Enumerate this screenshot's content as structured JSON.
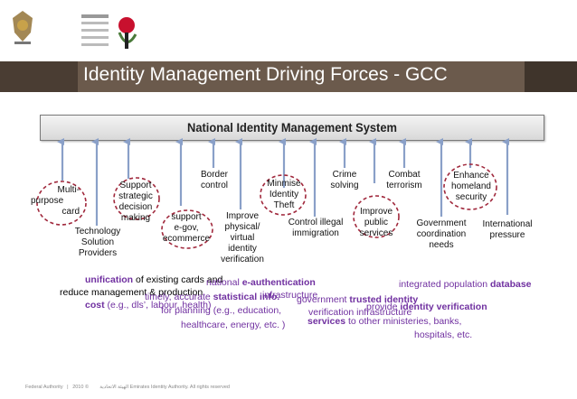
{
  "title": "Identity Management Driving Forces - GCC",
  "system_label": "National Identity Management System",
  "forces": [
    {
      "id": "multi",
      "text": [
        "Multi-",
        "purpose",
        "card"
      ]
    },
    {
      "id": "tech",
      "text": [
        "Technology",
        "Solution",
        "Providers"
      ]
    },
    {
      "id": "decision",
      "text": [
        "Support",
        "strategic",
        "decision",
        "making"
      ]
    },
    {
      "id": "egov",
      "text": [
        "support",
        "e-gov,",
        "ecommerce"
      ]
    },
    {
      "id": "border",
      "text": [
        "Border",
        "control"
      ]
    },
    {
      "id": "verify",
      "text": [
        "Improve",
        "physical/",
        "virtual",
        "identity",
        "verification"
      ]
    },
    {
      "id": "theft",
      "text": [
        "Minmise",
        "Identity",
        "Theft"
      ]
    },
    {
      "id": "illegal",
      "text": [
        "Control illegal",
        "immigration"
      ]
    },
    {
      "id": "crime",
      "text": [
        "Crime",
        "solving"
      ]
    },
    {
      "id": "public",
      "text": [
        "Improve",
        "public",
        "services"
      ]
    },
    {
      "id": "terror",
      "text": [
        "Combat",
        "terrorism"
      ]
    },
    {
      "id": "govcoord",
      "text": [
        "Government",
        "coordination",
        "needs"
      ]
    },
    {
      "id": "homeland",
      "text": [
        "Enhance",
        "homeland",
        "security"
      ]
    },
    {
      "id": "intl",
      "text": [
        "International",
        "pressure"
      ]
    }
  ],
  "notes": {
    "n1a_bold": "unification",
    "n1a": " of existing cards and",
    "n1b": "reduce management & production",
    "n1c_bold": "cost",
    "n1c": " (e.g., dls’, labour, health)",
    "n2a": "national ",
    "n2a_bold": "e-authentication",
    "n2b": "infrastructure",
    "n3a": "timely, accurate ",
    "n3a_bold": "statistical info.",
    "n3b": "for planning (e.g., education,",
    "n3c": "healthcare, energy, etc. )",
    "n4a": "integrated population ",
    "n4a_bold": "database",
    "n5a": "government ",
    "n5a_bold": "trusted identity",
    "n5b": "verification infrastructure",
    "n6a": "provide ",
    "n6a_bold": "identity verification",
    "n6b_bold": "services",
    "n6b": " to other ministeries, banks,",
    "n6c": "hospitals, etc."
  },
  "footer": {
    "org": "Federal Authority",
    "arabic": "الهيئة الاتحادية",
    "copyright": "© 2010 Emirates Identity Authority. All rights reserved"
  },
  "colors": {
    "title_bar": "#6b5a4c",
    "arrow": "#8aa0c8",
    "dashed": "#a0283c",
    "note_text": "#7030a0"
  }
}
